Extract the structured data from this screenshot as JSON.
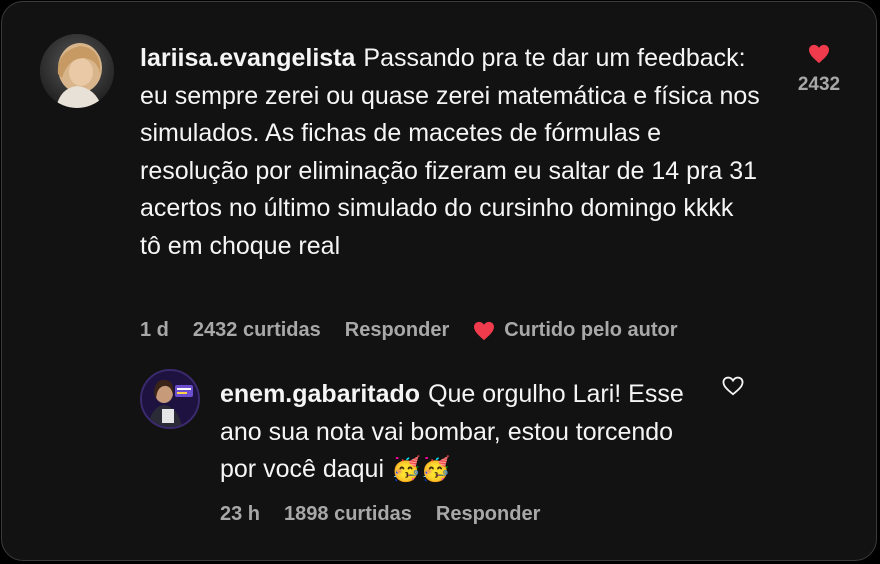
{
  "colors": {
    "background": "#121212",
    "text": "#f5f5f5",
    "muted": "#a8a8a8",
    "heart": "#ef3b4c"
  },
  "comment": {
    "username": "lariisa.evangelista",
    "text": "Passando pra te dar um feedback: eu sempre zerei ou quase zerei matemática e física nos simulados. As fichas de macetes de fórmulas e resolução por eliminação fizeram eu saltar de 14 pra 31 acertos no último simulado do cursinho domingo kkkk tô em choque real",
    "time": "1 d",
    "likes_text": "2432 curtidas",
    "reply_label": "Responder",
    "author_liked_label": "Curtido pelo autor",
    "like_count": "2432",
    "liked": true,
    "avatar_icon": "user-avatar-photo"
  },
  "reply": {
    "username": "enem.gabaritado",
    "text": "Que orgulho Lari! Esse ano sua nota vai bombar, estou torcendo por você daqui",
    "emojis": "🥳🥳",
    "time": "23 h",
    "likes_text": "1898 curtidas",
    "reply_label": "Responder",
    "liked": false,
    "avatar_icon": "brand-avatar-photo"
  }
}
